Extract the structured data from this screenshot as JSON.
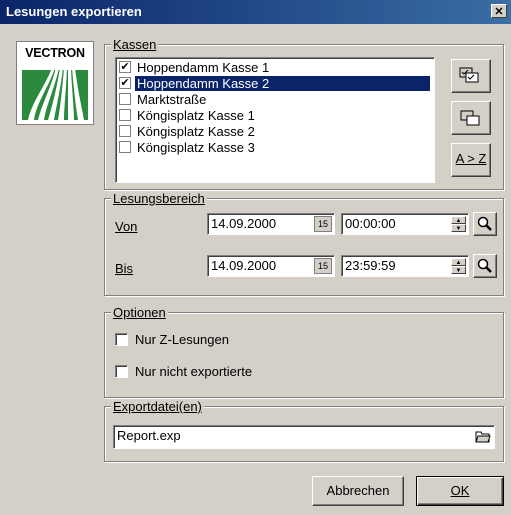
{
  "window": {
    "title": "Lesungen exportieren",
    "close": "✕"
  },
  "logo": {
    "brand": "VECTRON"
  },
  "kassen": {
    "legend": "Kassen",
    "items": [
      {
        "label": "Hoppendamm Kasse 1",
        "checked": true,
        "selected": false
      },
      {
        "label": "Hoppendamm Kasse 2",
        "checked": true,
        "selected": true
      },
      {
        "label": "Marktstraße",
        "checked": false,
        "selected": false
      },
      {
        "label": "Köngisplatz Kasse 1",
        "checked": false,
        "selected": false
      },
      {
        "label": "Köngisplatz Kasse 2",
        "checked": false,
        "selected": false
      },
      {
        "label": "Köngisplatz Kasse 3",
        "checked": false,
        "selected": false
      }
    ],
    "sort_label": "A > Z",
    "check_mark": "✔"
  },
  "bereich": {
    "legend": "Lesungsbereich",
    "von": {
      "label": "Von",
      "date": "14.09.2000",
      "time": "00:00:00"
    },
    "bis": {
      "label": "Bis",
      "date": "14.09.2000",
      "time": "23:59:59"
    },
    "calendar_glyph": "15"
  },
  "optionen": {
    "legend": "Optionen",
    "nur_z": "Nur Z-Lesungen",
    "nur_nicht": "Nur nicht exportierte"
  },
  "export": {
    "legend": "Exportdatei(en)",
    "filename": "Report.exp"
  },
  "buttons": {
    "cancel": "Abbrechen",
    "ok": "OK"
  }
}
